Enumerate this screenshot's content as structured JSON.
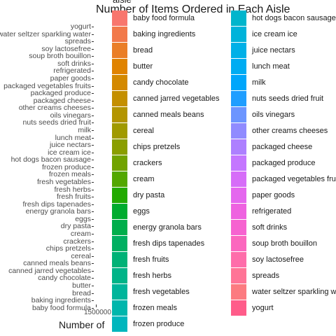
{
  "chart_data": {
    "type": "bar",
    "title": "Number of Items Ordered in Each Aisle",
    "xlabel": "Number of",
    "ylabel": "",
    "xtick_labels": [
      "1500000"
    ],
    "legend_title": "aisle",
    "legend_placement": "right",
    "grid": false,
    "categories": [
      "yogurt",
      "water seltzer sparkling water",
      "spreads",
      "soy lactosefree",
      "soup broth bouillon",
      "soft drinks",
      "refrigerated",
      "paper goods",
      "packaged vegetables fruits",
      "packaged produce",
      "packaged cheese",
      "other creams cheeses",
      "oils vinegars",
      "nuts seeds dried fruit",
      "milk",
      "lunch meat",
      "juice nectars",
      "ice cream ice",
      "hot dogs bacon sausage",
      "frozen produce",
      "frozen meals",
      "fresh vegetables",
      "fresh herbs",
      "fresh fruits",
      "fresh dips tapenades",
      "energy granola bars",
      "eggs",
      "dry pasta",
      "cream",
      "crackers",
      "chips pretzels",
      "cereal",
      "canned meals beans",
      "canned jarred vegetables",
      "candy chocolate",
      "butter",
      "bread",
      "baking ingredients",
      "baby food formula"
    ],
    "values": [],
    "legend": {
      "entries": [
        "baby food formula",
        "baking ingredients",
        "bread",
        "butter",
        "candy chocolate",
        "canned jarred vegetables",
        "canned meals beans",
        "cereal",
        "chips pretzels",
        "crackers",
        "cream",
        "dry pasta",
        "eggs",
        "energy granola bars",
        "fresh dips tapenades",
        "fresh fruits",
        "fresh herbs",
        "fresh vegetables",
        "frozen meals",
        "frozen produce",
        "hot dogs bacon sausage",
        "ice cream ice",
        "juice nectars",
        "lunch meat",
        "milk",
        "nuts seeds dried fruit",
        "oils vinegars",
        "other creams cheeses",
        "packaged cheese",
        "packaged produce",
        "packaged vegetables fruits",
        "paper goods",
        "refrigerated",
        "soft drinks",
        "soup broth bouillon",
        "soy lactosefree",
        "spreads",
        "water seltzer sparkling water",
        "yogurt"
      ],
      "colors": [
        "#F8766D",
        "#F2794A",
        "#EA7E27",
        "#E08300",
        "#D48900",
        "#C48F00",
        "#B39500",
        "#A09A00",
        "#8A9E00",
        "#71A300",
        "#52A700",
        "#22AA00",
        "#00AC2F",
        "#00AE4B",
        "#00B061",
        "#00B276",
        "#00B488",
        "#00B59B",
        "#00B6AC",
        "#00B6BD",
        "#00B5CC",
        "#00B3DA",
        "#00B0E7",
        "#00ACF2",
        "#00A6FB",
        "#1F9EFF",
        "#6C95FF",
        "#908BFF",
        "#AD80FF",
        "#C476FF",
        "#D66DF8",
        "#E467EE",
        "#EE62E0",
        "#F663D0",
        "#FB67BE",
        "#FE6DAA",
        "#FF7496",
        "#FC7B80",
        "#FF5C8A"
      ]
    }
  }
}
